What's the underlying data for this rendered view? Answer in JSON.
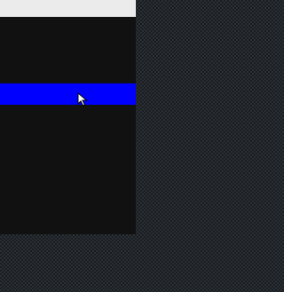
{
  "window": {
    "title": ""
  },
  "menu": {
    "items": [
      {
        "label": "",
        "state": "highlighted"
      }
    ]
  },
  "colors": {
    "title_bar": "#ebebeb",
    "menu_background": "#111111",
    "highlight": "#0000ff",
    "desktop_pattern": "#2a2f34"
  },
  "icons": {
    "cursor": "arrow-cursor-icon"
  }
}
